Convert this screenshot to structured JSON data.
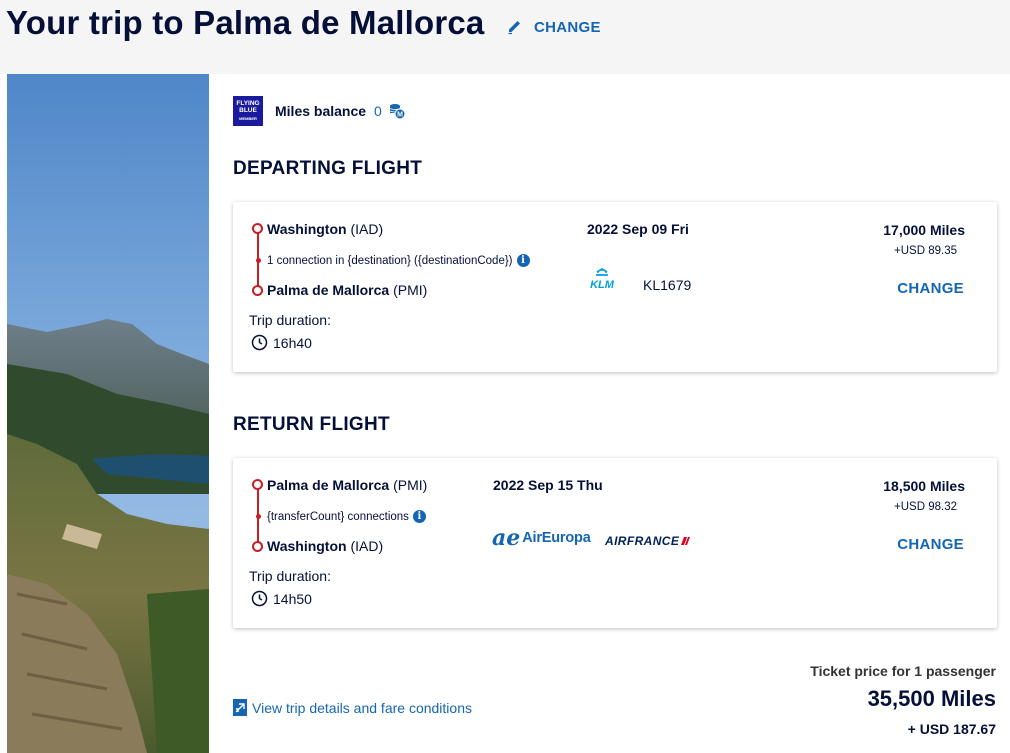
{
  "header": {
    "title": "Your trip to Palma de Mallorca",
    "change_label": "CHANGE"
  },
  "miles": {
    "logo_line1": "FLYING",
    "logo_line2": "BLUE",
    "logo_line3": "MEMBER",
    "label": "Miles balance",
    "value": "0"
  },
  "departing": {
    "section_title": "DEPARTING FLIGHT",
    "origin_city": "Washington",
    "origin_code": "(IAD)",
    "connection_text": "1 connection in {destination} ({destinationCode})",
    "dest_city": "Palma de Mallorca",
    "dest_code": "(PMI)",
    "duration_label": "Trip duration:",
    "duration": "16h40",
    "date": "2022 Sep 09 Fri",
    "airline_logo": "KLM",
    "flight_number": "KL1679",
    "price_miles": "17,000 Miles",
    "price_usd": "+USD 89.35",
    "change_label": "CHANGE"
  },
  "returning": {
    "section_title": "RETURN FLIGHT",
    "origin_city": "Palma de Mallorca",
    "origin_code": "(PMI)",
    "connection_text": "{transferCount} connections",
    "dest_city": "Washington",
    "dest_code": "(IAD)",
    "duration_label": "Trip duration:",
    "duration": "14h50",
    "date": "2022 Sep 15 Thu",
    "airline1_mark": "ae",
    "airline1_name": "AirEuropa",
    "airline2_name": "AIRFRANCE",
    "price_miles": "18,500 Miles",
    "price_usd": "+USD 98.32",
    "change_label": "CHANGE"
  },
  "footer": {
    "details_link": "View trip details and fare conditions",
    "ticket_label": "Ticket price for 1 passenger",
    "total_miles": "35,500 Miles",
    "total_usd": "+ USD 187.67"
  },
  "icons": {
    "edit": "pencil-icon",
    "coins": "miles-coins-icon",
    "info": "info-icon",
    "clock": "clock-icon",
    "plane": "plane-icon"
  },
  "colors": {
    "navy": "#051039",
    "link_blue": "#1466b3",
    "route_red": "#c81d25",
    "flying_blue": "#1a1a9c"
  }
}
